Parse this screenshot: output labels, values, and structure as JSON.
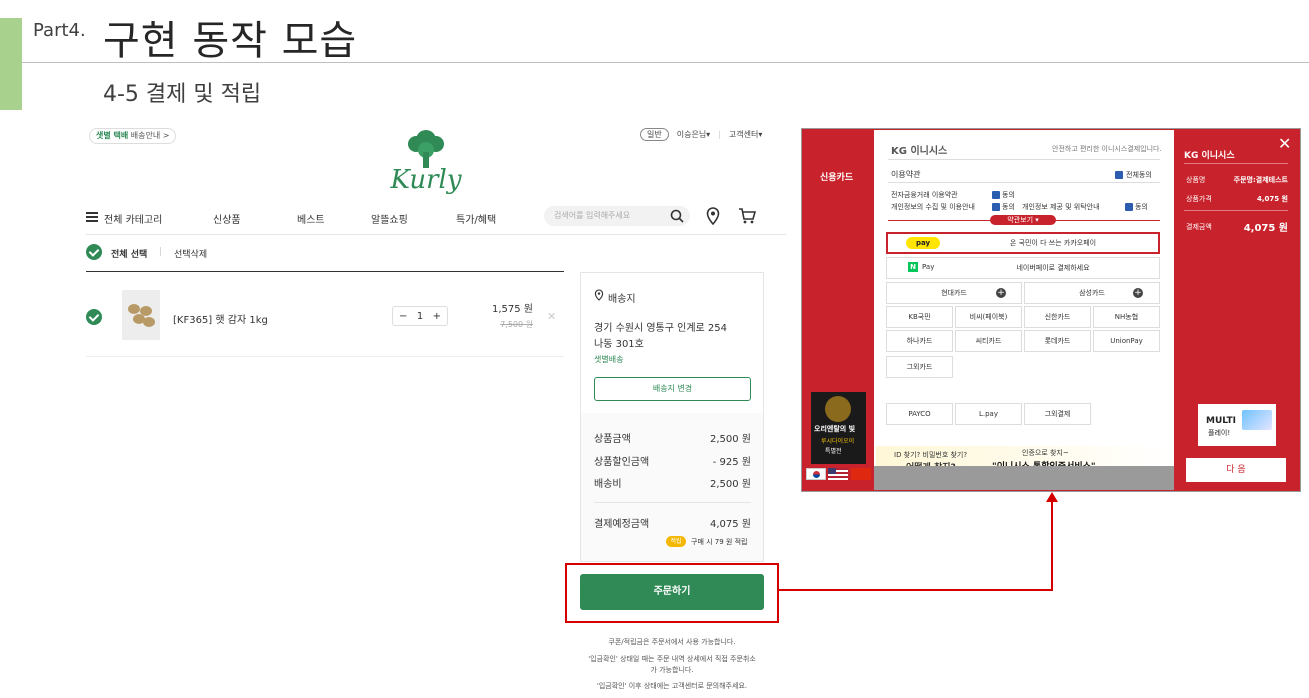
{
  "slide": {
    "part": "Part4.",
    "title": "구현 동작 모습",
    "subtitle": "4-5 결제 및 적립"
  },
  "kurly": {
    "top_badge_bold": "샛별 택배",
    "top_badge_text": "배송안내 >",
    "top_right": {
      "badge": "일반",
      "user": "이승은님▾",
      "help": "고객센터▾"
    },
    "logo_text": "Kurly",
    "nav": {
      "category": "전체 카테고리",
      "items": [
        "신상품",
        "베스트",
        "알뜰쇼핑",
        "특가/혜택"
      ],
      "search_placeholder": "검색어를 입력해주세요"
    },
    "select": {
      "all": "전체 선택",
      "delete": "선택삭제"
    },
    "item": {
      "name": "[KF365] 햇 감자 1kg",
      "qty": "1",
      "price": "1,575 원",
      "original_price": "7,500 원"
    },
    "shipping": {
      "title": "배송지",
      "address_line1": "경기 수원시 영통구 인계로 254",
      "address_line2": "나동 301호",
      "type": "샛별배송",
      "change_button": "배송지 변경"
    },
    "summary": {
      "rows": [
        {
          "label": "상품금액",
          "value": "2,500 원"
        },
        {
          "label": "상품할인금액",
          "value": "- 925 원"
        },
        {
          "label": "배송비",
          "value": "2,500 원"
        }
      ],
      "total_label": "결제예정금액",
      "total_value": "4,075 원",
      "point_badge": "적립",
      "point_text": "구매 시 79 원 적립"
    },
    "order_button": "주문하기",
    "notices": [
      "쿠폰/적립금은 주문서에서 사용 가능합니다.",
      "'입금확인' 상태일 때는 주문 내역 상세에서 직접 주문취소",
      "가 가능합니다.",
      "'입금확인' 이후 상태에는 고객센터로 문의해주세요."
    ]
  },
  "inicis": {
    "left_tab": "신용카드",
    "brand": "KG 이니시스",
    "tagline": "안전하고 편리한 이니시스결제입니다.",
    "terms_title": "이용약관",
    "agree_all": "전체동의",
    "term1": "전자금융거래 이용약관",
    "term2": "개인정보의 수집 및 이용안내",
    "term3": "개인정보 제공 및 위탁안내",
    "agree": "동의",
    "terms_view": "약관보기 ▾",
    "kakao_badge": "pay",
    "kakao_text": "온 국민이 다 쓰는 카카오페이",
    "naver_badge": "N",
    "naver_pay": "Pay",
    "naver_text": "네이버페이로 결제하세요",
    "card_big": [
      "현대카드",
      "삼성카드"
    ],
    "cards_row1": [
      "KB국민",
      "비씨(페이북)",
      "신한카드",
      "NH농협"
    ],
    "cards_row2": [
      "하나카드",
      "씨티카드",
      "롯데카드",
      "UnionPay"
    ],
    "cards_other": "그외카드",
    "pay_row": [
      "PAYCO",
      "L.pay",
      "그외결제"
    ],
    "right_brand": "KG 이니시스",
    "product_label": "상품명",
    "product_value": "주문명:결제테스트",
    "price_label": "상품가격",
    "price_value": "4,075 원",
    "total_label": "결제금액",
    "total_value": "4,075 원",
    "next_button": "다 음",
    "left_banner": {
      "line1": "오리엔탈의 빛",
      "line2": "루시다이오이",
      "line3": "특별전"
    },
    "right_banner": {
      "line1": "MULTI",
      "line2": "플레이!"
    },
    "id_banner": {
      "q": "ID 찾기? 비밀번호 찾기?",
      "q2": "어떻게 찾지?",
      "sub": "인증으로 찾지~",
      "main": "\"이니시스 통합인증서비스\""
    },
    "close": "✕",
    "colors": {
      "brand_red": "#c8232c",
      "kurly_green": "#2f8a56"
    }
  }
}
